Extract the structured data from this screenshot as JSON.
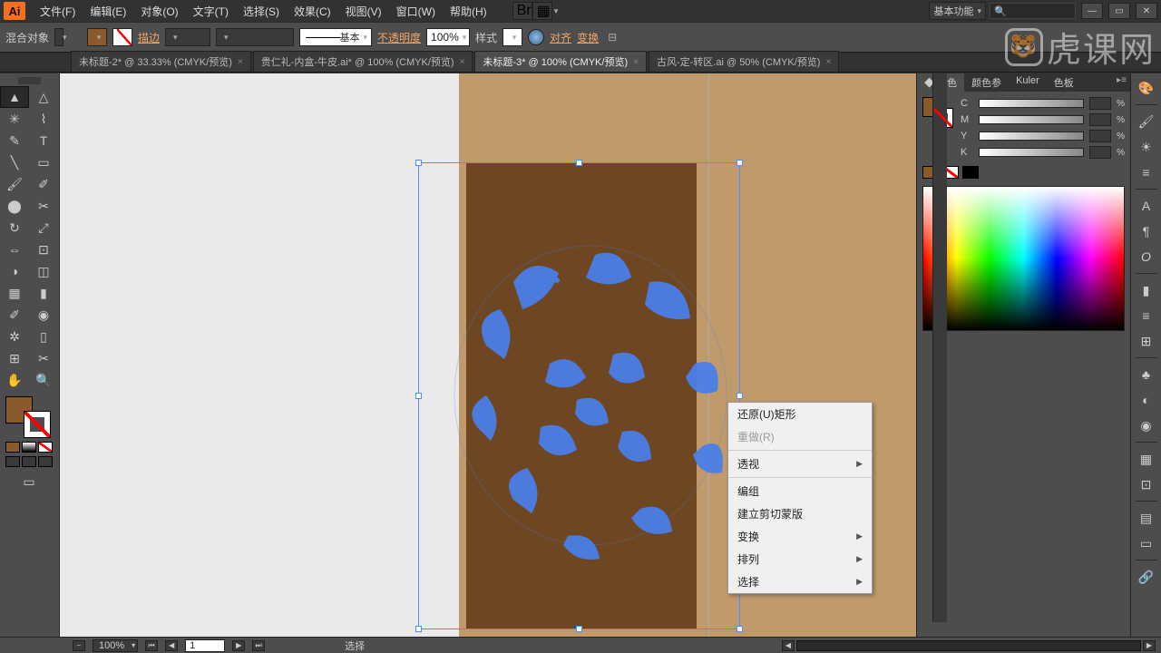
{
  "app": {
    "icon_text": "Ai"
  },
  "menus": [
    "文件(F)",
    "编辑(E)",
    "对象(O)",
    "文字(T)",
    "选择(S)",
    "效果(C)",
    "视图(V)",
    "窗口(W)",
    "帮助(H)"
  ],
  "workspace_label": "基本功能",
  "search_placeholder": "",
  "options": {
    "label": "混合对象",
    "stroke_label": "描边",
    "stroke_pt": "",
    "brush_preset": "基本",
    "opacity_label": "不透明度",
    "opacity_value": "100%",
    "style_label": "样式",
    "align_label": "对齐",
    "transform_label": "变换"
  },
  "tabs": [
    {
      "title": "未标题-2* @ 33.33% (CMYK/预览)",
      "active": false
    },
    {
      "title": "贵仁礼-内盒-牛皮.ai* @ 100% (CMYK/预览)",
      "active": false
    },
    {
      "title": "未标题-3* @ 100% (CMYK/预览)",
      "active": true
    },
    {
      "title": "古风-定-转区.ai @ 50% (CMYK/预览)",
      "active": false
    }
  ],
  "context_menu": [
    {
      "label": "还原(U)矩形",
      "type": "item"
    },
    {
      "label": "重做(R)",
      "type": "item",
      "disabled": true
    },
    {
      "type": "sep"
    },
    {
      "label": "透视",
      "type": "sub"
    },
    {
      "type": "sep"
    },
    {
      "label": "编组",
      "type": "item"
    },
    {
      "label": "建立剪切蒙版",
      "type": "item"
    },
    {
      "label": "变换",
      "type": "sub"
    },
    {
      "label": "排列",
      "type": "sub"
    },
    {
      "label": "选择",
      "type": "sub"
    }
  ],
  "panels": {
    "color_tabs": [
      "颜色",
      "颜色参",
      "Kuler",
      "色板"
    ],
    "channels": [
      "C",
      "M",
      "Y",
      "K"
    ]
  },
  "status": {
    "zoom": "100%",
    "artboard_num": "1",
    "mode": "选择"
  },
  "watermark": "虎课网",
  "colors": {
    "artboard": "#c19a6b",
    "panel_brown": "#6e4621",
    "selection": "#4a90ff"
  }
}
